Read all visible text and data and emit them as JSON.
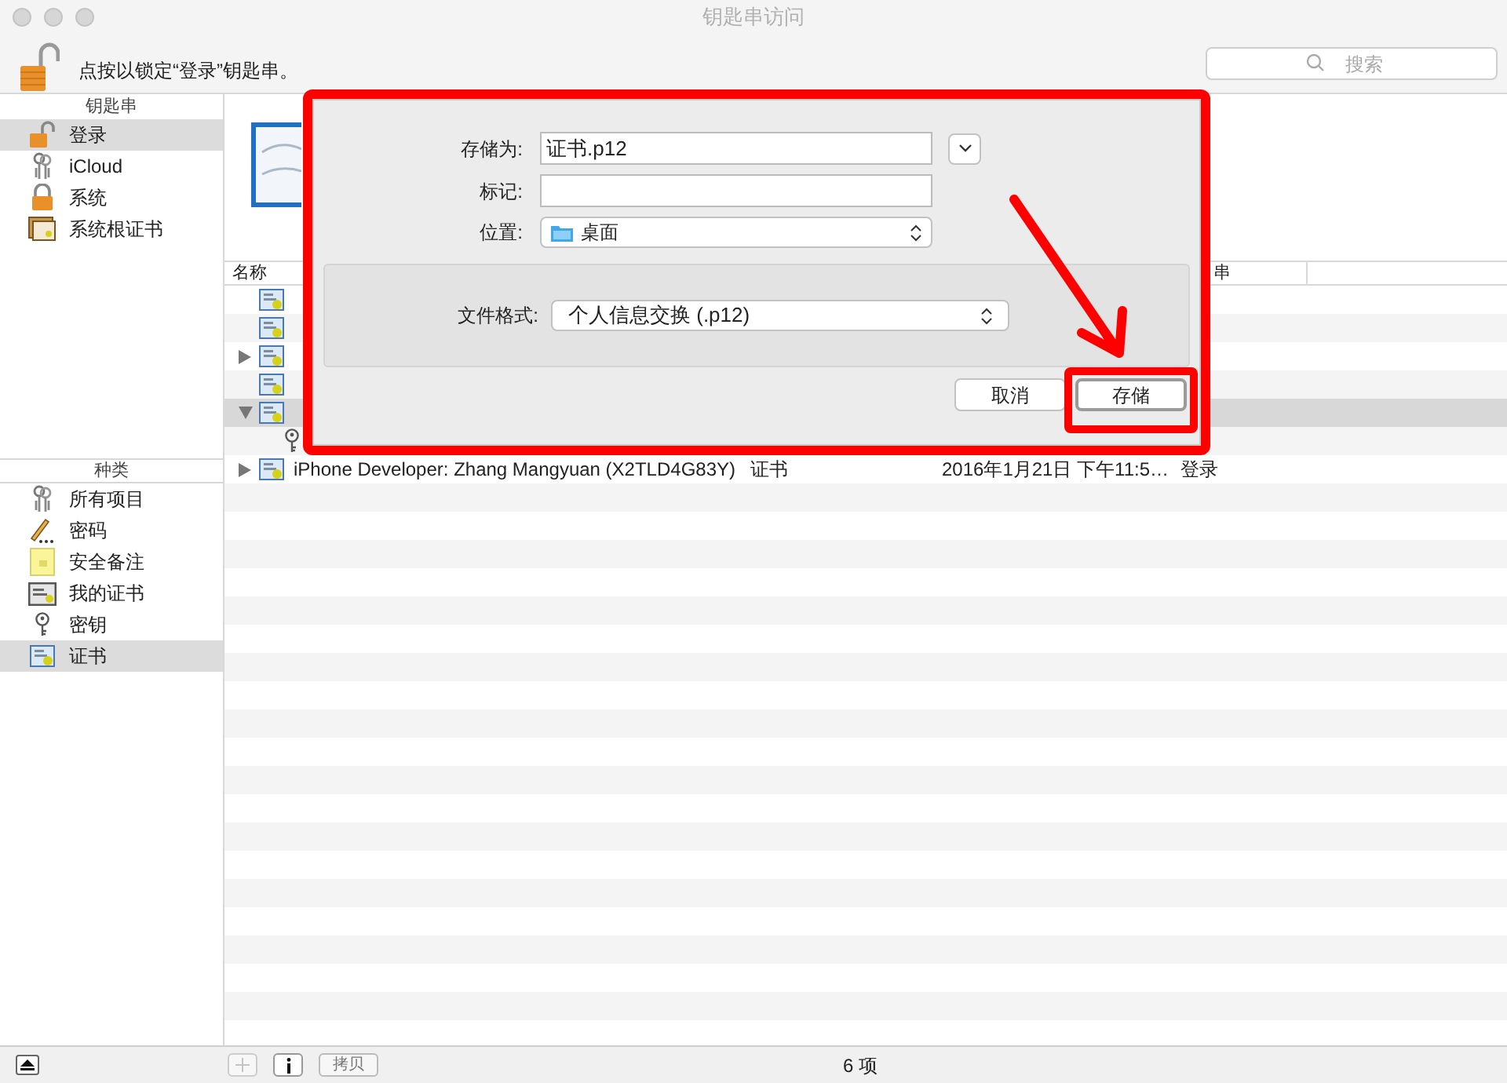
{
  "window": {
    "title": "钥匙串访问"
  },
  "toolbar": {
    "lock_text": "点按以锁定“登录”钥匙串。",
    "search": {
      "placeholder": "搜索"
    }
  },
  "sidebar": {
    "keychains": {
      "header": "钥匙串",
      "items": [
        {
          "label": "登录",
          "selected": true
        },
        {
          "label": "iCloud",
          "selected": false
        },
        {
          "label": "系统",
          "selected": false
        },
        {
          "label": "系统根证书",
          "selected": false
        }
      ]
    },
    "categories": {
      "header": "种类",
      "items": [
        {
          "label": "所有项目",
          "selected": false
        },
        {
          "label": "密码",
          "selected": false
        },
        {
          "label": "安全备注",
          "selected": false
        },
        {
          "label": "我的证书",
          "selected": false
        },
        {
          "label": "密钥",
          "selected": false
        },
        {
          "label": "证书",
          "selected": true
        }
      ]
    }
  },
  "table": {
    "columns": [
      "名称",
      "串"
    ],
    "rows": [
      {
        "kind": "certificate",
        "selected": false
      },
      {
        "kind": "certificate",
        "selected": false
      },
      {
        "kind": "certificate",
        "expanded": false,
        "selected": false
      },
      {
        "kind": "certificate",
        "selected": false
      },
      {
        "kind": "certificate",
        "expanded": true,
        "selected": true
      },
      {
        "kind": "key",
        "selected": false
      },
      {
        "kind": "certificate",
        "expanded": false,
        "name": "iPhone Developer: Zhang Mangyuan (X2TLD4G83Y)",
        "type": "证书",
        "date": "2016年1月21日 下午11:5…",
        "keychain": "登录",
        "selected": false
      }
    ]
  },
  "dialog": {
    "save_as": {
      "label": "存储为:",
      "value": "证书.p12"
    },
    "tags": {
      "label": "标记:"
    },
    "location": {
      "label": "位置:",
      "value": "桌面"
    },
    "format": {
      "label": "文件格式:",
      "value": "个人信息交换 (.p12)"
    },
    "buttons": [
      {
        "label": "取消",
        "default": false
      },
      {
        "label": "存储",
        "default": true
      }
    ]
  },
  "status_bar": {
    "copy_button": "拷贝",
    "count": "6 项"
  }
}
